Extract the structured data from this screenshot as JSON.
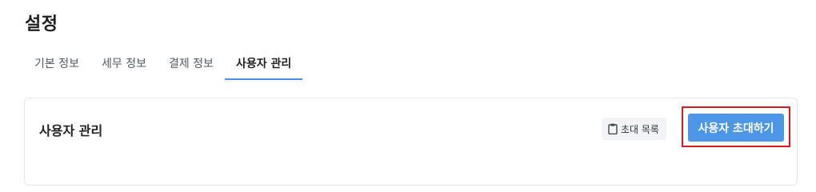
{
  "page": {
    "title": "설정"
  },
  "tabs": [
    {
      "label": "기본 정보",
      "active": false
    },
    {
      "label": "세무 정보",
      "active": false
    },
    {
      "label": "결제 정보",
      "active": false
    },
    {
      "label": "사용자 관리",
      "active": true
    }
  ],
  "section": {
    "title": "사용자 관리",
    "invite_list_label": "초대 목록",
    "invite_list_icon": "clipboard-icon",
    "invite_user_label": "사용자 초대하기"
  },
  "colors": {
    "accent": "#4d96e6",
    "highlight": "#d71920",
    "tab_underline": "#4a90e2"
  }
}
